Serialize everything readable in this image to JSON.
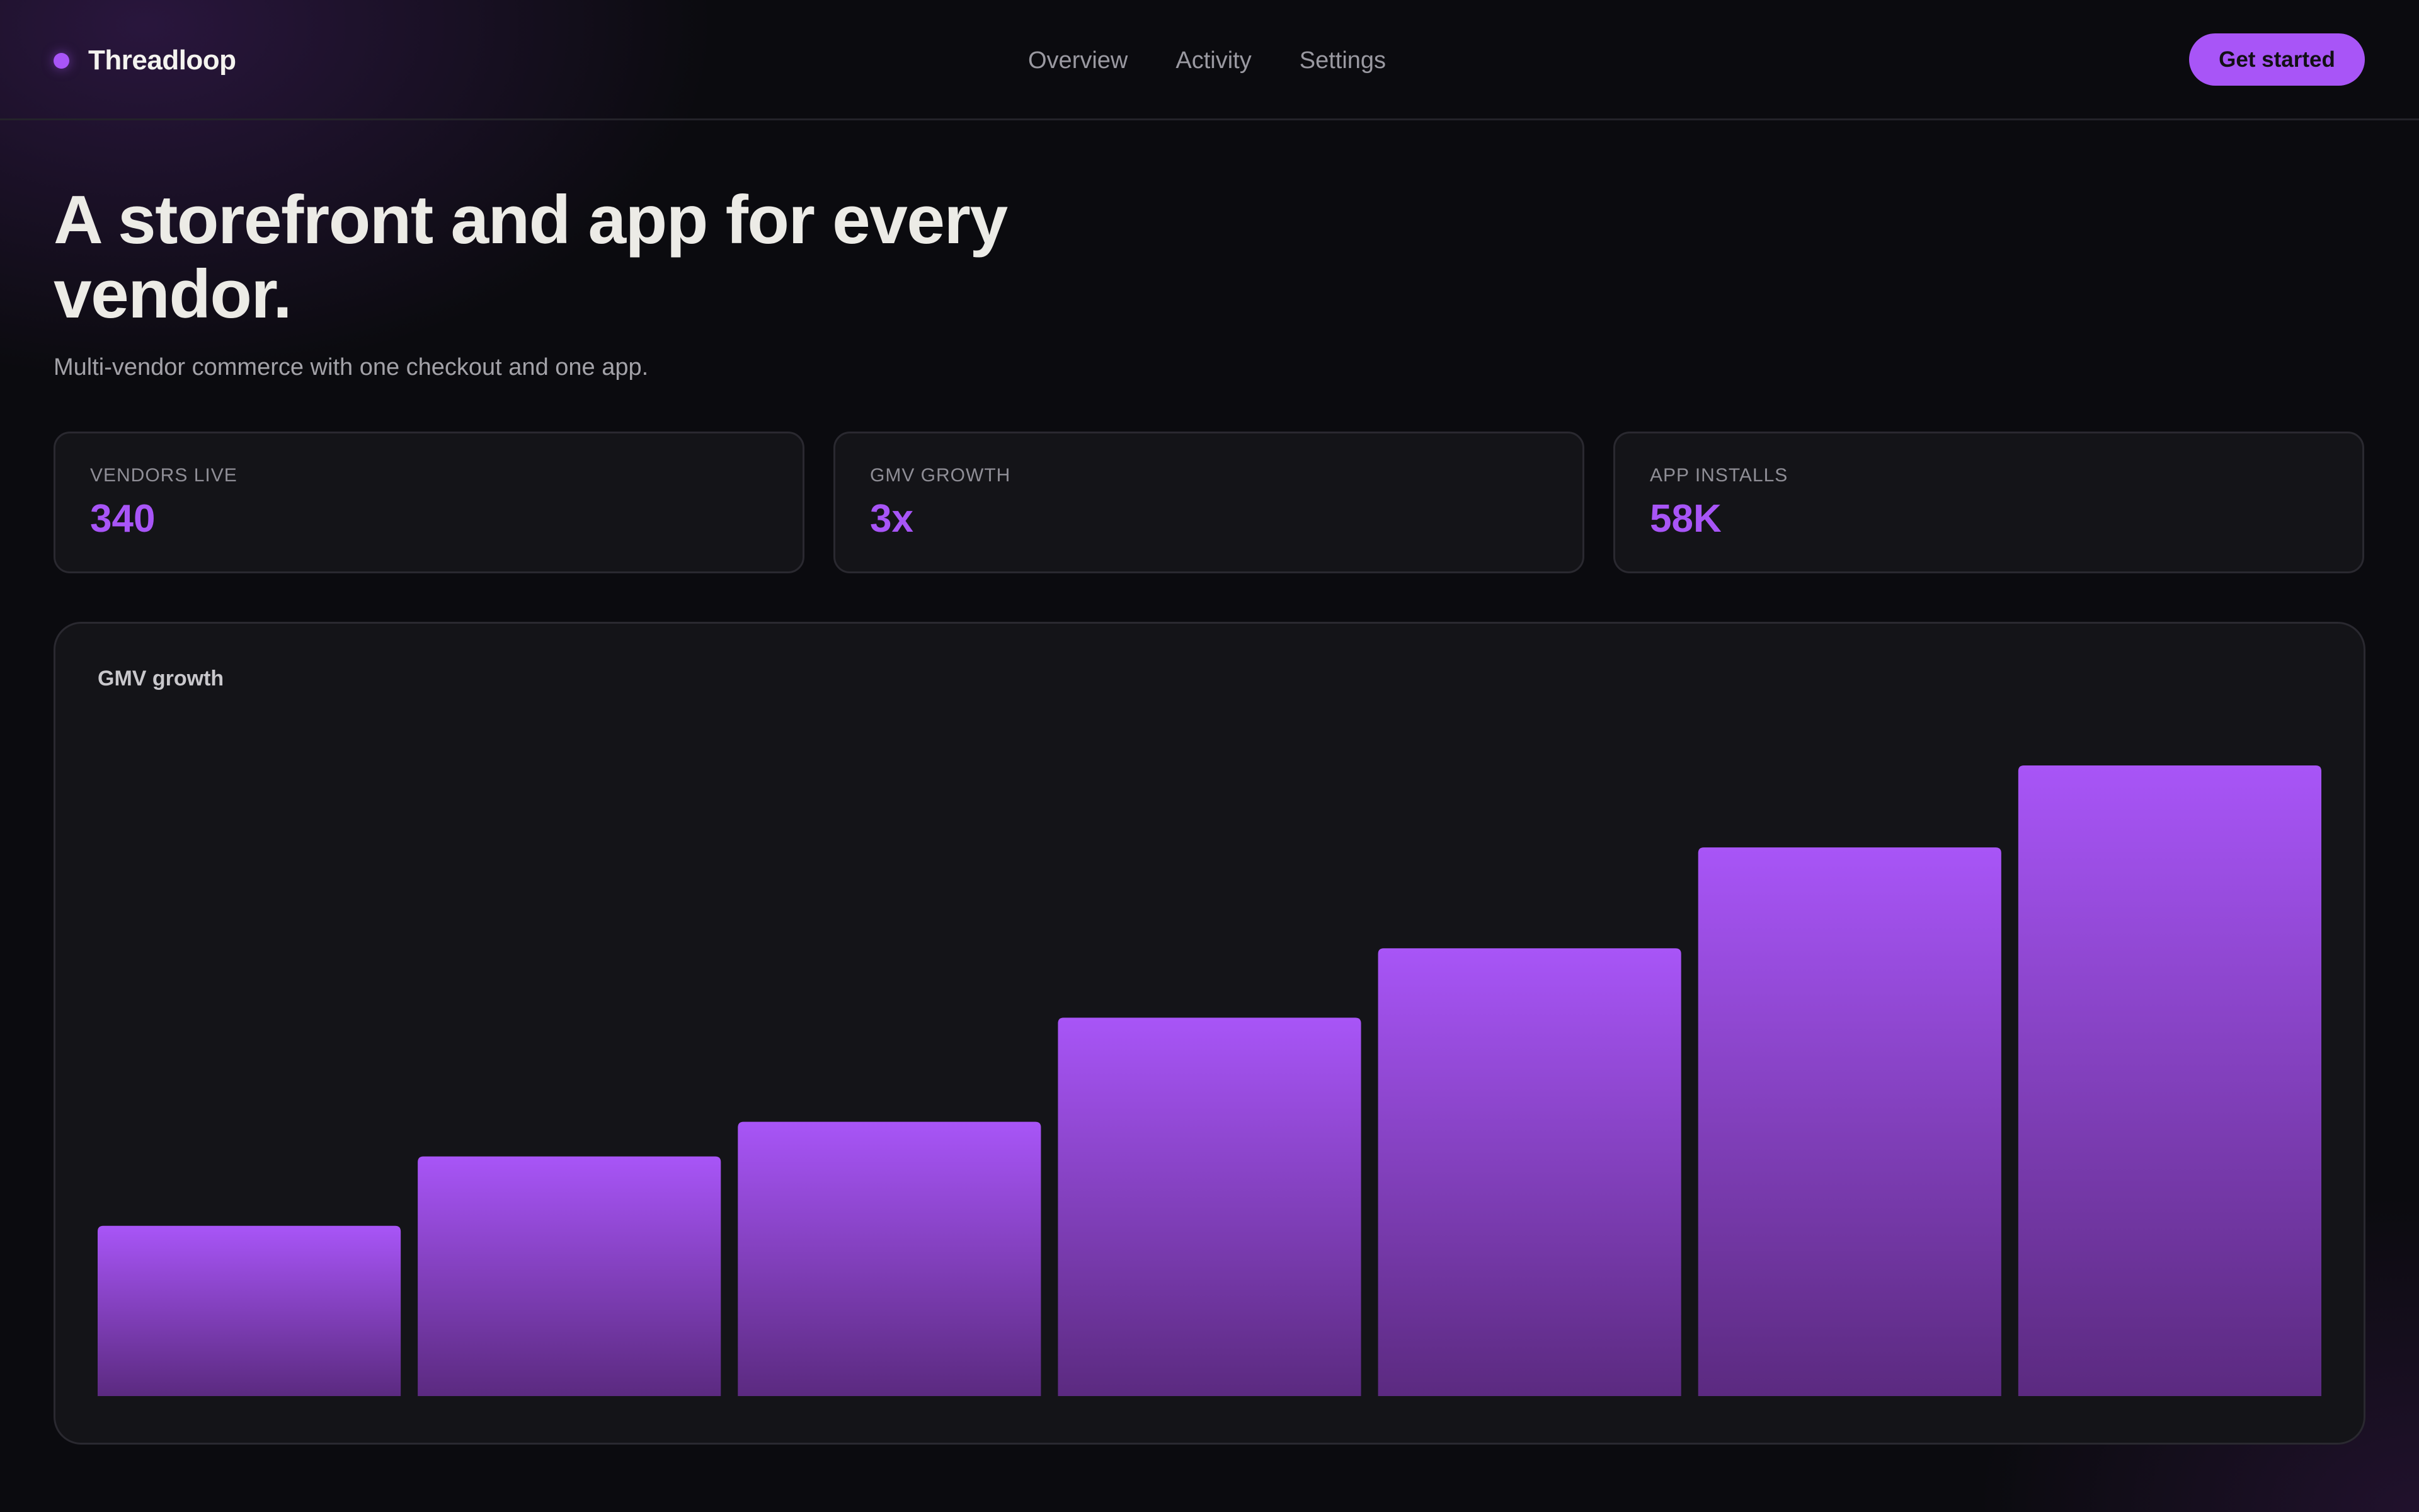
{
  "header": {
    "brand": "Threadloop",
    "nav": [
      "Overview",
      "Activity",
      "Settings"
    ],
    "cta_label": "Get started"
  },
  "hero": {
    "title": "A storefront and app for every vendor.",
    "subtitle": "Multi-vendor commerce with one checkout and one app."
  },
  "stats": [
    {
      "label": "VENDORS LIVE",
      "value": "340"
    },
    {
      "label": "GMV GROWTH",
      "value": "3x"
    },
    {
      "label": "APP INSTALLS",
      "value": "58K"
    }
  ],
  "colors": {
    "accent": "#a855f7",
    "background": "#0b0b0f",
    "card": "#141418"
  },
  "icons": {
    "brand_mark": "brand-dot-icon"
  },
  "chart_data": {
    "type": "bar",
    "title": "GMV growth",
    "xlabel": "",
    "ylabel": "",
    "categories": [],
    "values": [
      27,
      38,
      43.5,
      60,
      71,
      87,
      100
    ],
    "ylim": [
      0,
      100
    ],
    "grid": false,
    "legend": "none",
    "bar_gradient": [
      "#a855f7",
      "#5b2a80"
    ]
  }
}
